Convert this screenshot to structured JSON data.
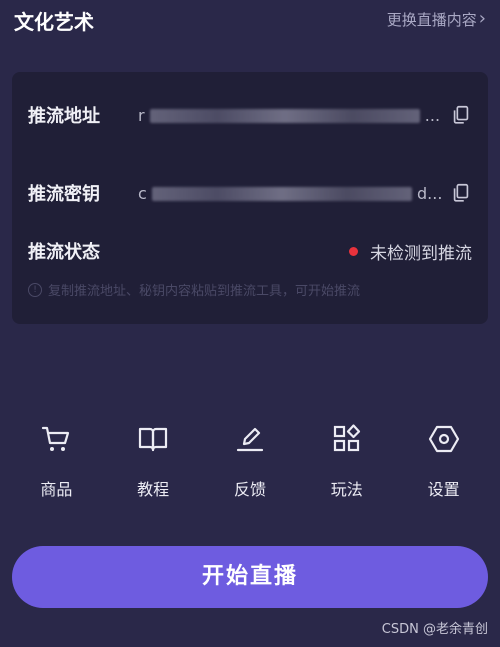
{
  "header": {
    "category": "文化艺术",
    "change_link": "更换直播内容",
    "change_icon": "chevron-right-icon"
  },
  "stream": {
    "address": {
      "label": "推流地址",
      "value_prefix": "r",
      "value_suffix": "...",
      "copy_icon": "copy-icon"
    },
    "key": {
      "label": "推流密钥",
      "value_prefix": "c",
      "value_suffix": "d...",
      "copy_icon": "copy-icon"
    },
    "status": {
      "label": "推流状态",
      "value": "未检测到推流",
      "indicator_color": "#e8323c"
    },
    "hint": "复制推流地址、秘钥内容粘贴到推流工具，可开始推流"
  },
  "tools": [
    {
      "label": "商品",
      "icon": "cart-icon"
    },
    {
      "label": "教程",
      "icon": "book-icon"
    },
    {
      "label": "反馈",
      "icon": "edit-icon"
    },
    {
      "label": "玩法",
      "icon": "apps-icon"
    },
    {
      "label": "设置",
      "icon": "settings-icon"
    }
  ],
  "start_button": "开始直播",
  "watermark": "CSDN @老余青创",
  "colors": {
    "background": "#2a2849",
    "card": "#201f37",
    "accent": "#6e5ce0",
    "status_dot": "#e8323c"
  }
}
